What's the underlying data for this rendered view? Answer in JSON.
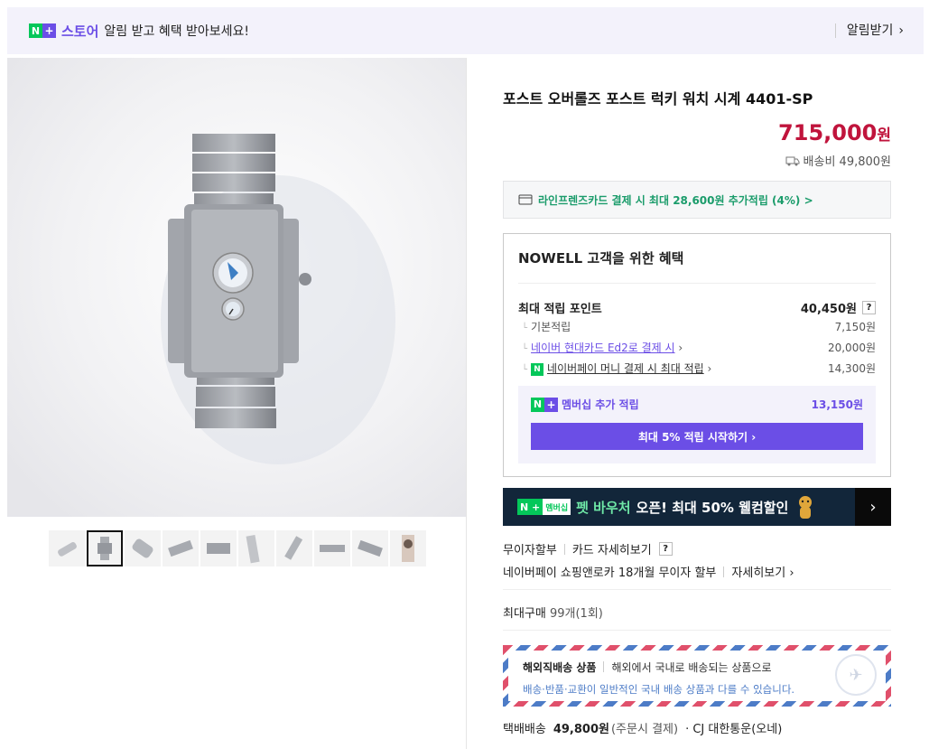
{
  "topbar": {
    "n_badge": "N",
    "plus_badge": "+",
    "brand": "스토어",
    "message": "알림 받고 혜택 받아보세요!",
    "alarm_label": "알림받기",
    "alarm_arrow": "›"
  },
  "product": {
    "title": "포스트 오버롤즈 포스트 럭키 워치 시계 4401-SP",
    "price": "715,000",
    "price_unit": "원",
    "shipping_label": "배송비 49,800원"
  },
  "card_promo": {
    "text": "라인프렌즈카드 결제 시 최대 28,600원 추가적립 (4%) >"
  },
  "benefits": {
    "title": "NOWELL 고객을 위한 혜택",
    "max_points_label": "최대 적립 포인트",
    "max_points_value": "40,450원",
    "help_mark": "?",
    "rows": [
      {
        "label": "기본적립",
        "value": "7,150원"
      },
      {
        "label": "네이버 현대카드 Ed2로 결제 시",
        "arrow": "›",
        "value": "20,000원"
      },
      {
        "label": "네이버페이 머니 결제 시 최대 적립",
        "arrow": "›",
        "value": "14,300원"
      }
    ],
    "np_icon": "N",
    "membership_label": "멤버십 추가 적립",
    "membership_value": "13,150원",
    "membership_button": "최대 5% 적립 시작하기 ›"
  },
  "banner": {
    "badge_n": "N +",
    "badge_m": "멤버십",
    "mint_text": "펫 바우처",
    "text": "오픈! 최대 50% 웰컴할인",
    "arrow": "›"
  },
  "payment": {
    "installment": "무이자할부",
    "card_detail": "카드 자세히보기",
    "help_mark": "?",
    "npay_installment": "네이버페이 쇼핑앤로카 18개월 무이자 할부",
    "detail_link": "자세히보기 ›"
  },
  "max_buy": {
    "label": "최대구매",
    "value": "99개(1회)"
  },
  "overseas": {
    "title": "해외직배송 상품",
    "desc": "해외에서 국내로 배송되는 상품으로",
    "note": "배송·반품·교환이 일반적인 국내 배송 상품과 다를 수 있습니다.",
    "stamp_glyph": "✈"
  },
  "delivery": {
    "method": "택배배송",
    "fee": "49,800원",
    "fee_note": "(주문시 결제)",
    "carrier": "· CJ 대한통운(오네)"
  },
  "colors": {
    "accent": "#6b4ee6",
    "price": "#c0143c",
    "naver_green": "#04c75a"
  }
}
